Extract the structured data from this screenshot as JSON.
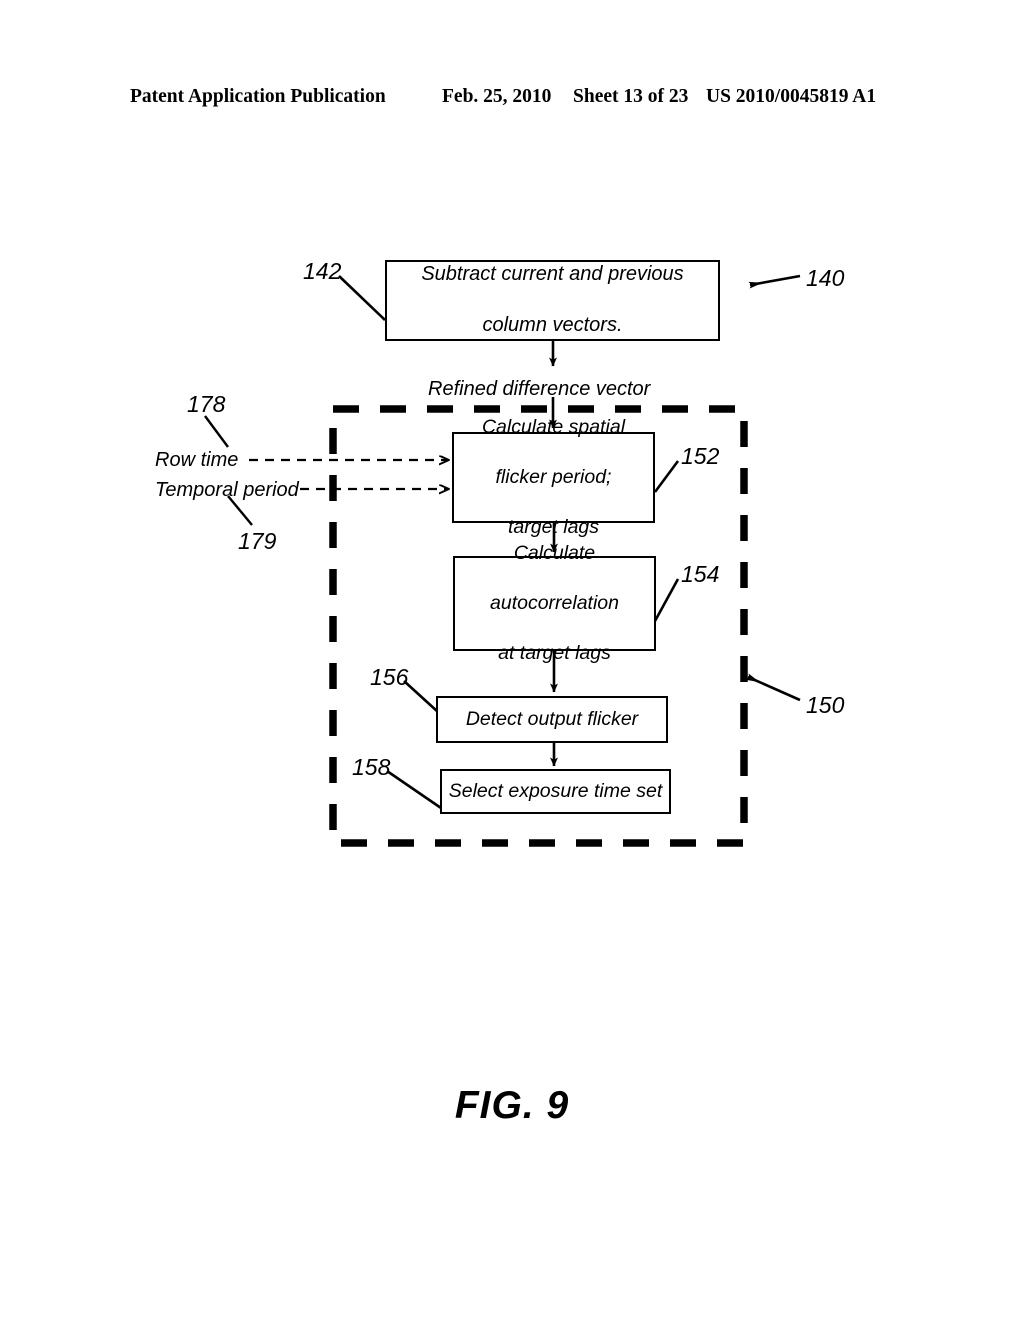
{
  "header": {
    "publication": "Patent Application Publication",
    "date": "Feb. 25, 2010",
    "sheet": "Sheet 13 of 23",
    "patent_number": "US 2010/0045819 A1"
  },
  "figure": {
    "caption": "FIG. 9",
    "overall_ref": "140",
    "group_ref": "150"
  },
  "boxes": [
    {
      "ref": "142",
      "text_line1": "Subtract current and previous",
      "text_line2": "column vectors."
    },
    {
      "ref": "152",
      "text_line1": "Calculate spatial",
      "text_line2": "flicker period;",
      "text_line3": "target lags"
    },
    {
      "ref": "154",
      "text_line1": "Calculate",
      "text_line2": "autocorrelation",
      "text_line3": "at target lags"
    },
    {
      "ref": "156",
      "text_line1": "Detect output flicker"
    },
    {
      "ref": "158",
      "text_line1": "Select exposure time set"
    }
  ],
  "inputs": [
    {
      "ref": "178",
      "label": "Row time"
    },
    {
      "ref": "179",
      "label": "Temporal period"
    }
  ],
  "flow_labels": {
    "refined_difference_vector": "Refined difference vector"
  },
  "colors": {
    "ink": "#000000",
    "paper": "#ffffff"
  }
}
